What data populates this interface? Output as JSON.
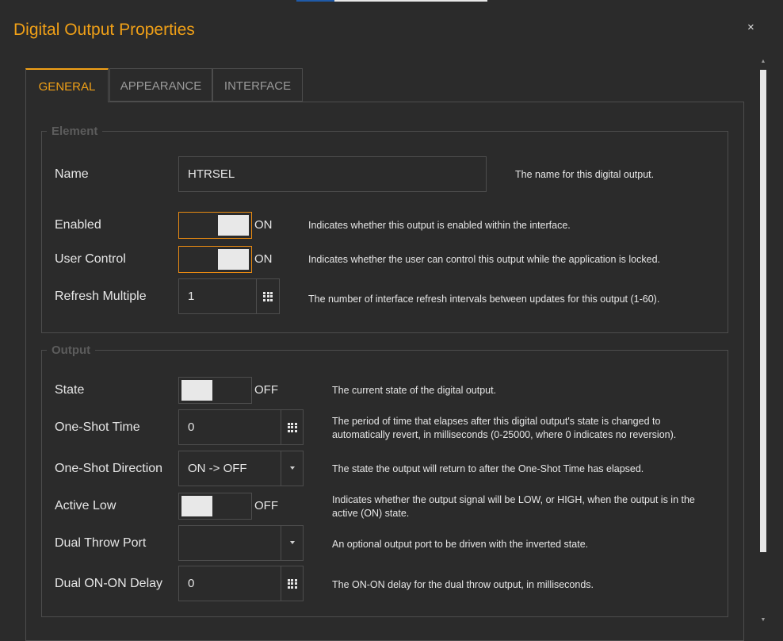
{
  "dialog": {
    "title": "Digital Output Properties",
    "close_glyph": "×"
  },
  "tabs": [
    {
      "label": "GENERAL",
      "active": true
    },
    {
      "label": "APPEARANCE",
      "active": false
    },
    {
      "label": "INTERFACE",
      "active": false
    }
  ],
  "colors": {
    "accent": "#f0a017",
    "toggle_on_border": "#e88a12",
    "background": "#2b2b2b",
    "border": "#4d4d4d"
  },
  "element": {
    "legend": "Element",
    "name": {
      "label": "Name",
      "value": "HTRSEL",
      "description": "The name for this digital output."
    },
    "enabled": {
      "label": "Enabled",
      "state": "ON",
      "description": "Indicates whether this output is enabled within the interface."
    },
    "user_control": {
      "label": "User Control",
      "state": "ON",
      "description": "Indicates whether the user can control this output while the application is locked."
    },
    "refresh_multiple": {
      "label": "Refresh Multiple",
      "value": "1",
      "description": "The number of interface refresh intervals between updates for this output (1-60)."
    }
  },
  "output": {
    "legend": "Output",
    "state": {
      "label": "State",
      "state": "OFF",
      "description": "The current state of the digital output."
    },
    "one_shot_time": {
      "label": "One-Shot Time",
      "value": "0",
      "description": "The period of time that elapses after this digital output's state is changed to automatically revert, in milliseconds (0-25000, where 0 indicates no reversion)."
    },
    "one_shot_direction": {
      "label": "One-Shot Direction",
      "value": "ON -> OFF",
      "description": "The state the output will return to after the One-Shot Time has elapsed."
    },
    "active_low": {
      "label": "Active Low",
      "state": "OFF",
      "description": "Indicates whether the output signal will be LOW, or HIGH, when the output is in the active (ON) state."
    },
    "dual_throw_port": {
      "label": "Dual Throw Port",
      "value": "",
      "description": "An optional output port to be driven with the inverted state."
    },
    "dual_on_on_delay": {
      "label": "Dual ON-ON Delay",
      "value": "0",
      "description": "The ON-ON delay for the dual throw output, in milliseconds."
    }
  },
  "icons": {
    "keypad": "keypad-icon",
    "dropdown": "chevron-down-icon",
    "close": "close-icon",
    "scroll_up": "scroll-up-arrow-icon",
    "scroll_down": "scroll-down-arrow-icon"
  }
}
